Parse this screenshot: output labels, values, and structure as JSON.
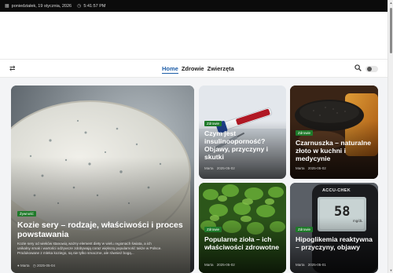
{
  "topbar": {
    "date": "poniedziałek, 19 stycznia, 2026",
    "time": "5:41:57 PM"
  },
  "nav": {
    "items": [
      "Home",
      "Zdrowie",
      "Zwierzęta"
    ],
    "active": "Home"
  },
  "featured": {
    "category": "Żywność",
    "title": "Kozie sery – rodzaje, właściwości i proces powstawania",
    "excerpt_line1": "Kozie sery od wieków stanowią ważny element diety w wielu regionach świata, a ich",
    "excerpt_line2": "unikalny smak i wartości odżywcze zdobywają coraz większą popularność także w Polsce.",
    "excerpt_line3": "Produkowane z mleka koziego, są nie tylko smaczne, ale również bogą...",
    "author": "Marta",
    "date": "2025-05-04"
  },
  "posts": [
    {
      "category": "Zdrowie",
      "title": "Czym jest insulinooporność? Objawy, przyczyny i skutki",
      "author": "Marta",
      "date": "2025-05-02"
    },
    {
      "category": "Zdrowie",
      "title": "Czarnuszka – naturalne złoto w kuchni i medycynie",
      "author": "Marta",
      "date": "2025-05-02"
    },
    {
      "category": "Zdrowie",
      "title": "Popularne zioła – ich właściwości zdrowotne",
      "author": "Marta",
      "date": "2025-05-02"
    },
    {
      "category": "Zdrowie",
      "title": "Hipoglikemia reaktywna – przyczyny, objawy",
      "author": "Marta",
      "date": "2025-05-01"
    }
  ],
  "glucometer": {
    "brand": "ACCU-CHEK",
    "reading": "58",
    "unit": "mg/dL"
  },
  "colors": {
    "accent": "#1e5ea8",
    "badge": "#1f7a2a",
    "topbar": "#0b0b0b"
  }
}
